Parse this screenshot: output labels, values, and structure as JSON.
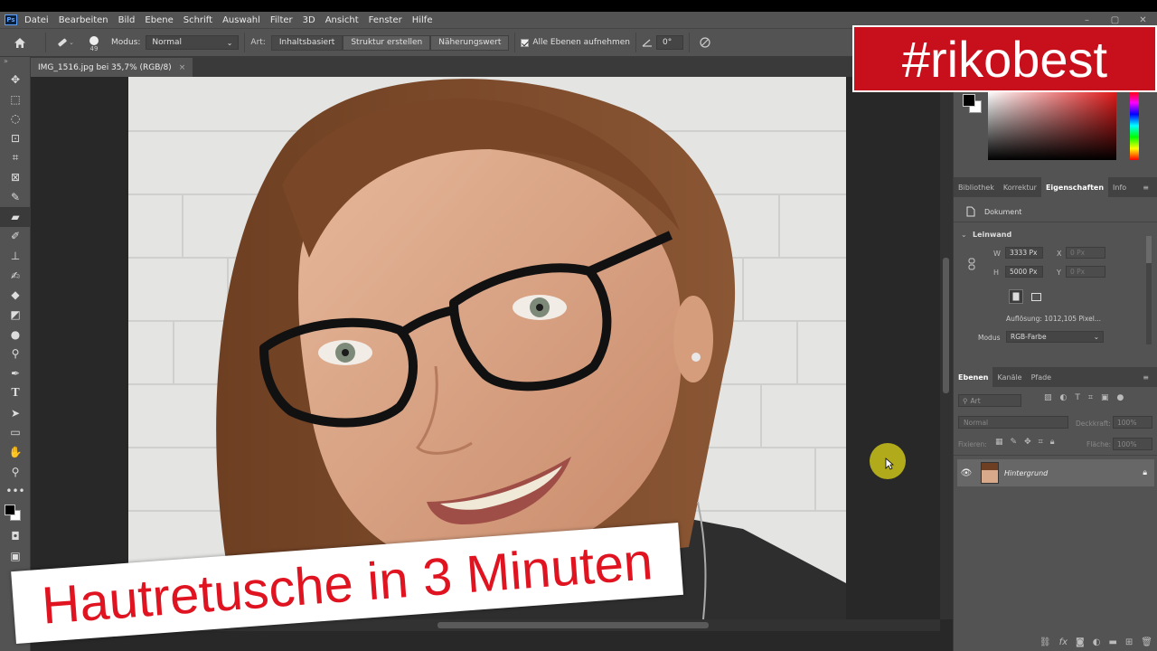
{
  "menubar": {
    "items": [
      "Datei",
      "Bearbeiten",
      "Bild",
      "Ebene",
      "Schrift",
      "Auswahl",
      "Filter",
      "3D",
      "Ansicht",
      "Fenster",
      "Hilfe"
    ],
    "app_logo": "Ps",
    "window_controls": [
      "–",
      "▢",
      "✕"
    ]
  },
  "optionsbar": {
    "brush_size": "49",
    "modus_label": "Modus:",
    "modus_value": "Normal",
    "art_label": "Art:",
    "art_options": [
      "Inhaltsbasiert",
      "Struktur erstellen",
      "Näherungswert"
    ],
    "sample_all_label": "Alle Ebenen aufnehmen",
    "angle_value": "0°"
  },
  "document": {
    "tab_title": "IMG_1516.jpg bei 35,7% (RGB/8)",
    "close": "×"
  },
  "toolbar": {
    "tools": [
      "move-icon",
      "marquee-icon",
      "lasso-icon",
      "quick-select-icon",
      "crop-icon",
      "frame-icon",
      "eyedropper-icon",
      "healing-brush-icon",
      "brush-icon",
      "stamp-icon",
      "history-brush-icon",
      "eraser-icon",
      "paint-bucket-icon",
      "blur-icon",
      "dodge-icon",
      "pen-icon",
      "type-icon",
      "path-select-icon",
      "shape-icon",
      "hand-icon",
      "zoom-icon",
      "more-icon"
    ],
    "active_tool": "healing-brush-icon"
  },
  "properties": {
    "tabs": [
      "Bibliothek",
      "Korrektur",
      "Eigenschaften",
      "Info"
    ],
    "active_tab": "Eigenschaften",
    "dokument_label": "Dokument",
    "leinwand_label": "Leinwand",
    "w_label": "W",
    "w_value": "3333 Px",
    "h_label": "H",
    "h_value": "5000 Px",
    "x_label": "X",
    "x_value": "0 Px",
    "y_label": "Y",
    "y_value": "0 Px",
    "aufloesung": "Auflösung: 1012,105 Pixel...",
    "modus_label": "Modus",
    "modus_value": "RGB-Farbe"
  },
  "layers": {
    "tabs": [
      "Ebenen",
      "Kanäle",
      "Pfade"
    ],
    "active_tab": "Ebenen",
    "filter_placeholder": "Art",
    "blend_mode": "Normal",
    "opacity_label": "Deckkraft:",
    "opacity_value": "100%",
    "lock_label": "Fixieren:",
    "fill_label": "Fläche:",
    "fill_value": "100%",
    "layer_name": "Hintergrund"
  },
  "overlay": {
    "hashtag": "#rikobest",
    "title": "Hautretusche in 3 Minuten"
  },
  "colors": {
    "accent_red": "#c8101d",
    "title_red": "#e01420",
    "cursor_highlight": "#c9c21a"
  }
}
